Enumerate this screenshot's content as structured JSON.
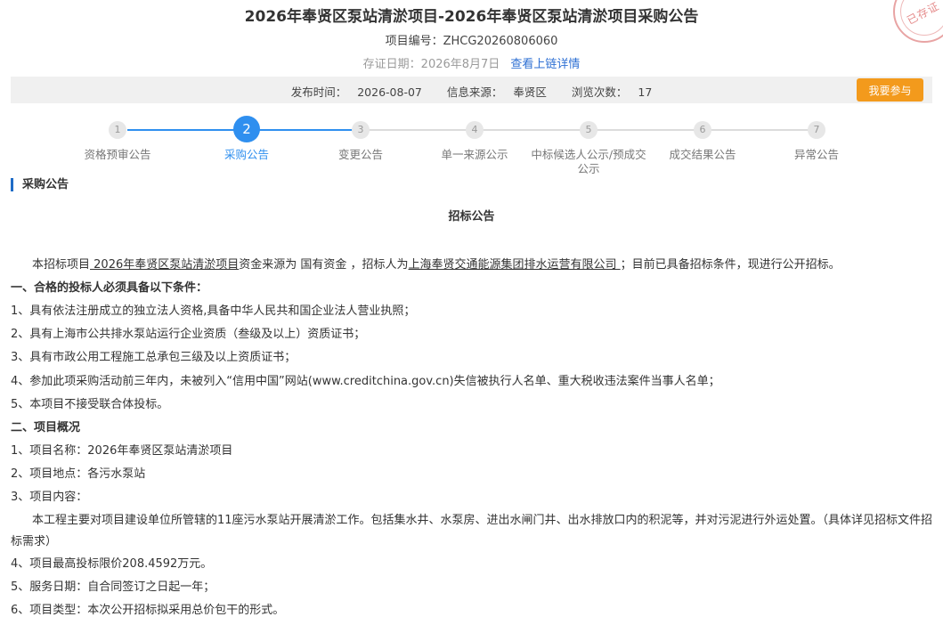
{
  "header": {
    "title": "2026年奉贤区泵站清淤项目-2026年奉贤区泵站清淤项目采购公告",
    "project_no_label": "项目编号：",
    "project_no": "ZHCG20260806060",
    "cert_date_label": "存证日期：",
    "cert_date": "2026年8月7日",
    "chain_link": "查看上链详情",
    "stamp_text": "已存证"
  },
  "meta": {
    "publish_label": "发布时间：",
    "publish_date": "2026-08-07",
    "source_label": "信息来源：",
    "source": "奉贤区",
    "views_label": "浏览次数：",
    "views": "17",
    "join_button": "我要参与"
  },
  "steps": [
    {
      "num": "1",
      "label": "资格预审公告"
    },
    {
      "num": "2",
      "label": "采购公告"
    },
    {
      "num": "3",
      "label": "变更公告"
    },
    {
      "num": "4",
      "label": "单一来源公示"
    },
    {
      "num": "5",
      "label": "中标候选人公示/预成交公示"
    },
    {
      "num": "6",
      "label": "成交结果公告"
    },
    {
      "num": "7",
      "label": "异常公告"
    }
  ],
  "section_title": "采购公告",
  "doc": {
    "title": "招标公告",
    "intro": {
      "p1": "本招标项目",
      "project_name": "  2026年奉贤区泵站清淤项目",
      "p2": "资金来源为 国有资金 ，招标人为",
      "tenderer": "上海奉贤交通能源集团排水运营有限公司  ",
      "p3": "；目前已具备招标条件，现进行公开招标。"
    },
    "h1": "一、合格的投标人必须具备以下条件：",
    "req": [
      "1、具有依法注册成立的独立法人资格,具备中华人民共和国企业法人营业执照；",
      "2、具有上海市公共排水泵站运行企业资质（叁级及以上）资质证书；",
      "3、具有市政公用工程施工总承包三级及以上资质证书；",
      "4、参加此项采购活动前三年内，未被列入“信用中国”网站(www.creditchina.gov.cn)失信被执行人名单、重大税收违法案件当事人名单；",
      "5、本项目不接受联合体投标。"
    ],
    "h2": "二、项目概况",
    "overview": {
      "i1": "1、项目名称：2026年奉贤区泵站清淤项目",
      "i2": "2、项目地点：各污水泵站",
      "i3": "3、项目内容：",
      "content": "本工程主要对项目建设单位所管辖的11座污水泵站开展清淤工作。包括集水井、水泵房、进出水闸门井、出水排放口内的积泥等，并对污泥进行外运处置。（具体详见招标文件招标需求）",
      "i4": "4、项目最高投标限价208.4592万元。",
      "i5": "5、服务日期：自合同签订之日起一年；",
      "i6": "6、项目类型：本次公开招标拟采用总价包干的形式。"
    }
  }
}
